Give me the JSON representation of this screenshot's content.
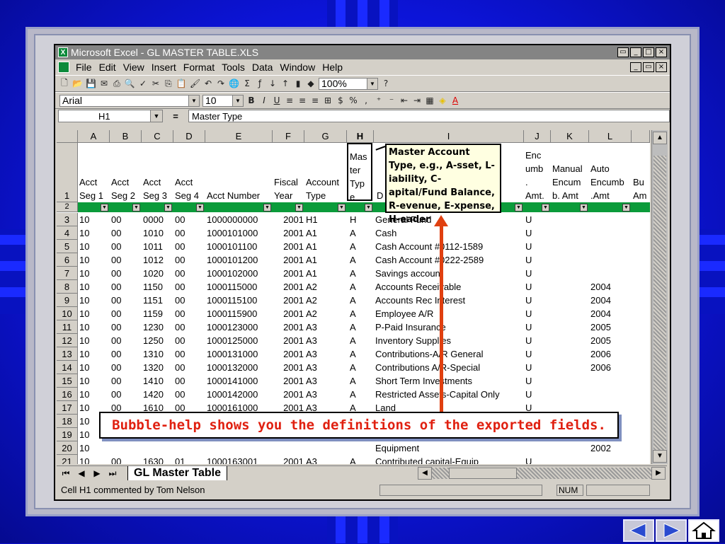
{
  "window": {
    "title": "Microsoft Excel - GL MASTER TABLE.XLS",
    "title_buttons": [
      "▭",
      "_",
      "□",
      "×"
    ],
    "doc_buttons": [
      "_",
      "▭",
      "×"
    ]
  },
  "menu": {
    "items": [
      "File",
      "Edit",
      "View",
      "Insert",
      "Format",
      "Tools",
      "Data",
      "Window",
      "Help"
    ]
  },
  "toolbar": {
    "zoom": "100%",
    "font_name": "Arial",
    "font_size": "10"
  },
  "formula_bar": {
    "cell_ref": "H1",
    "eq": "=",
    "content": "Master Type"
  },
  "columns": [
    "A",
    "B",
    "C",
    "D",
    "E",
    "F",
    "G",
    "H",
    "I",
    "J",
    "K",
    "L"
  ],
  "header_row": {
    "row_num": "1",
    "a": "Acct\nSeg 1",
    "b": "Acct\nSeg 2",
    "c": "Acct\nSeg 3",
    "d": "Acct\nSeg 4",
    "e": "Acct Number",
    "f": "Fiscal\nYear",
    "g": "Account\nType",
    "h": "Mas\nter\nTyp\ne",
    "i": "D",
    "j": "Enc\numb\n.\nAmt.",
    "k": "Manual\nEncum\nb. Amt",
    "l": "Auto\nEncumb\n.Amt",
    "m": "Bu\nAm"
  },
  "row2_num": "2",
  "rows": [
    {
      "n": "3",
      "a": "10",
      "b": "00",
      "c": "0000",
      "d": "00",
      "e": "1000000000",
      "f": "2001",
      "g": "H1",
      "h": "H",
      "i": "General Fund",
      "j": "U",
      "l": ""
    },
    {
      "n": "4",
      "a": "10",
      "b": "00",
      "c": "1010",
      "d": "00",
      "e": "1000101000",
      "f": "2001",
      "g": "A1",
      "h": "A",
      "i": "Cash",
      "j": "U",
      "l": ""
    },
    {
      "n": "5",
      "a": "10",
      "b": "00",
      "c": "1011",
      "d": "00",
      "e": "1000101100",
      "f": "2001",
      "g": "A1",
      "h": "A",
      "i": "Cash Account #0112-1589",
      "j": "U",
      "l": ""
    },
    {
      "n": "6",
      "a": "10",
      "b": "00",
      "c": "1012",
      "d": "00",
      "e": "1000101200",
      "f": "2001",
      "g": "A1",
      "h": "A",
      "i": "Cash Account #0222-2589",
      "j": "U",
      "l": ""
    },
    {
      "n": "7",
      "a": "10",
      "b": "00",
      "c": "1020",
      "d": "00",
      "e": "1000102000",
      "f": "2001",
      "g": "A1",
      "h": "A",
      "i": "Savings account",
      "j": "U",
      "l": ""
    },
    {
      "n": "8",
      "a": "10",
      "b": "00",
      "c": "1150",
      "d": "00",
      "e": "1000115000",
      "f": "2001",
      "g": "A2",
      "h": "A",
      "i": "Accounts Receivable",
      "j": "U",
      "l": "2004"
    },
    {
      "n": "9",
      "a": "10",
      "b": "00",
      "c": "1151",
      "d": "00",
      "e": "1000115100",
      "f": "2001",
      "g": "A2",
      "h": "A",
      "i": "Accounts Rec Interest",
      "j": "U",
      "l": "2004"
    },
    {
      "n": "10",
      "a": "10",
      "b": "00",
      "c": "1159",
      "d": "00",
      "e": "1000115900",
      "f": "2001",
      "g": "A2",
      "h": "A",
      "i": "Employee A/R",
      "j": "U",
      "l": "2004"
    },
    {
      "n": "11",
      "a": "10",
      "b": "00",
      "c": "1230",
      "d": "00",
      "e": "1000123000",
      "f": "2001",
      "g": "A3",
      "h": "A",
      "i": "P-Paid Insurance",
      "j": "U",
      "l": "2005"
    },
    {
      "n": "12",
      "a": "10",
      "b": "00",
      "c": "1250",
      "d": "00",
      "e": "1000125000",
      "f": "2001",
      "g": "A3",
      "h": "A",
      "i": "Inventory Supplies",
      "j": "U",
      "l": "2005"
    },
    {
      "n": "13",
      "a": "10",
      "b": "00",
      "c": "1310",
      "d": "00",
      "e": "1000131000",
      "f": "2001",
      "g": "A3",
      "h": "A",
      "i": "Contributions-A/R General",
      "j": "U",
      "l": "2006"
    },
    {
      "n": "14",
      "a": "10",
      "b": "00",
      "c": "1320",
      "d": "00",
      "e": "1000132000",
      "f": "2001",
      "g": "A3",
      "h": "A",
      "i": "Contributions A/R-Special",
      "j": "U",
      "l": "2006"
    },
    {
      "n": "15",
      "a": "10",
      "b": "00",
      "c": "1410",
      "d": "00",
      "e": "1000141000",
      "f": "2001",
      "g": "A3",
      "h": "A",
      "i": "Short Term Investments",
      "j": "U",
      "l": ""
    },
    {
      "n": "16",
      "a": "10",
      "b": "00",
      "c": "1420",
      "d": "00",
      "e": "1000142000",
      "f": "2001",
      "g": "A3",
      "h": "A",
      "i": "Restricted Assets-Capital Only",
      "j": "U",
      "l": ""
    },
    {
      "n": "17",
      "a": "10",
      "b": "00",
      "c": "1610",
      "d": "00",
      "e": "1000161000",
      "f": "2001",
      "g": "A3",
      "h": "A",
      "i": "Land",
      "j": "U",
      "l": ""
    },
    {
      "n": "18",
      "a": "10",
      "b": "",
      "c": "",
      "d": "",
      "e": "",
      "f": "",
      "g": "",
      "h": "",
      "i": "",
      "j": "",
      "l": ""
    },
    {
      "n": "19",
      "a": "10",
      "b": "",
      "c": "",
      "d": "",
      "e": "",
      "f": "",
      "g": "",
      "h": "",
      "i": "",
      "j": "",
      "l": ""
    },
    {
      "n": "20",
      "a": "10",
      "b": "",
      "c": "",
      "d": "",
      "e": "",
      "f": "",
      "g": "",
      "h": "",
      "i": "Equipment",
      "j": "",
      "l": "2002"
    },
    {
      "n": "21",
      "a": "10",
      "b": "00",
      "c": "1630",
      "d": "01",
      "e": "1000163001",
      "f": "2001",
      "g": "A3",
      "h": "A",
      "i": "Contributed capital-Equip",
      "j": "U",
      "l": ""
    }
  ],
  "comment_bubble": "Master Account Type, e.g., A-sset, L-iability, C-apital/Fund Balance, R-evenue, E-xpense, H-eader",
  "sheet_tab": "GL Master Table",
  "status": {
    "text": "Cell H1 commented by Tom Nelson",
    "num": "NUM"
  },
  "banner": "Bubble-help shows you the definitions of the exported fields."
}
